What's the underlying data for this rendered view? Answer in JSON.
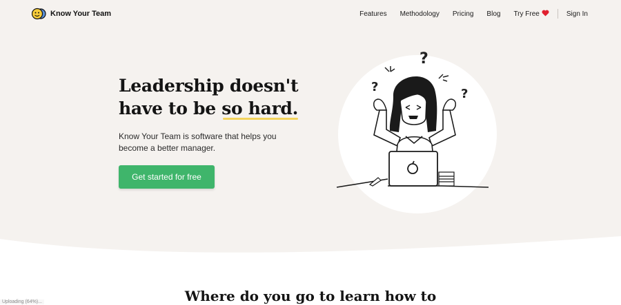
{
  "brand": {
    "name": "Know Your Team",
    "logo_icon": "smiley-logo-icon"
  },
  "nav": {
    "items": [
      "Features",
      "Methodology",
      "Pricing",
      "Blog"
    ],
    "try_free": "Try Free",
    "try_free_icon": "heart-icon",
    "sign_in": "Sign In"
  },
  "hero": {
    "headline_line1": "Leadership doesn't",
    "headline_line2_a": "have to be ",
    "headline_line2_b": "so hard.",
    "subtext": "Know Your Team is software that helps you become a better manager.",
    "cta": "Get started for free"
  },
  "section": {
    "title": "Where do you go to learn how to"
  },
  "status": "Uploading (64%)...",
  "colors": {
    "hero_bg": "#f5f2ef",
    "cta": "#3fb56b",
    "highlight": "#f3d35b",
    "heart": "#e0202f"
  }
}
